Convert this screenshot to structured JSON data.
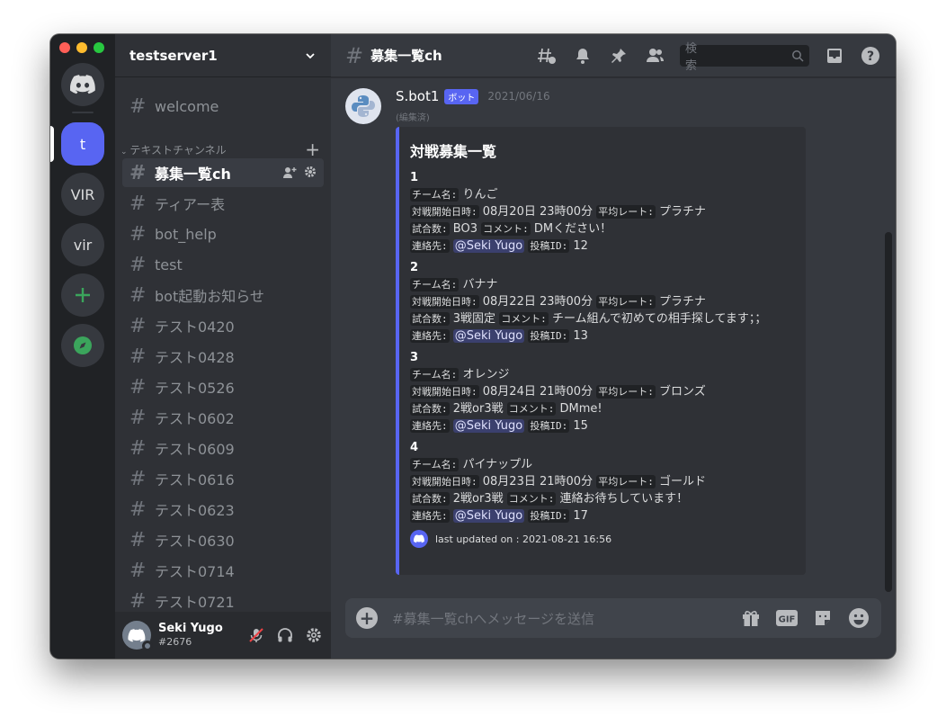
{
  "server": {
    "name": "testserver1",
    "rail": [
      {
        "label": "t"
      },
      {
        "label": "VIR"
      },
      {
        "label": "vir"
      }
    ]
  },
  "sidebar": {
    "top_channel": "welcome",
    "category": "テキストチャンネル",
    "channels": [
      {
        "label": "募集一覧ch",
        "selected": true
      },
      {
        "label": "ティアー表"
      },
      {
        "label": "bot_help"
      },
      {
        "label": "test"
      },
      {
        "label": "bot起動お知らせ"
      },
      {
        "label": "テスト0420"
      },
      {
        "label": "テスト0428"
      },
      {
        "label": "テスト0526"
      },
      {
        "label": "テスト0602"
      },
      {
        "label": "テスト0609"
      },
      {
        "label": "テスト0616"
      },
      {
        "label": "テスト0623"
      },
      {
        "label": "テスト0630"
      },
      {
        "label": "テスト0714"
      },
      {
        "label": "テスト0721"
      }
    ]
  },
  "user": {
    "name": "Seki Yugo",
    "tag": "#2676"
  },
  "topbar": {
    "channel": "募集一覧ch",
    "search_placeholder": "検索"
  },
  "message": {
    "author": "S.bot1",
    "badge": "ボット",
    "timestamp": "2021/06/16",
    "edited": "(編集済)",
    "embed": {
      "title": "対戦募集一覧",
      "labels": {
        "team": "チーム名:",
        "start": "対戦開始日時:",
        "rate": "平均レート:",
        "games": "試合数:",
        "comment": "コメント:",
        "contact": "連絡先:",
        "post_id": "投稿ID:"
      },
      "entries": [
        {
          "num": "1",
          "team": "りんご",
          "start": "08月20日 23時00分",
          "rate": "プラチナ",
          "games": "BO3",
          "comment": "DMください！",
          "contact": "@Seki Yugo",
          "post_id": "12"
        },
        {
          "num": "2",
          "team": "バナナ",
          "start": "08月22日 23時00分",
          "rate": "プラチナ",
          "games": "3戦固定",
          "comment": "チーム組んで初めての相手探してます；；",
          "contact": "@Seki Yugo",
          "post_id": "13"
        },
        {
          "num": "3",
          "team": "オレンジ",
          "start": "08月24日 21時00分",
          "rate": "ブロンズ",
          "games": "2戦or3戦",
          "comment": "DMme!",
          "contact": "@Seki Yugo",
          "post_id": "15"
        },
        {
          "num": "4",
          "team": "パイナップル",
          "start": "08月23日 21時00分",
          "rate": "ゴールド",
          "games": "2戦or3戦",
          "comment": "連絡お待ちしています！",
          "contact": "@Seki Yugo",
          "post_id": "17"
        }
      ],
      "footer": "last updated on : 2021-08-21 16:56"
    }
  },
  "composer": {
    "placeholder": "#募集一覧chへメッセージを送信"
  },
  "colors": {
    "blurple": "#5865f2",
    "green": "#3ba55c",
    "red": "#ed4245"
  }
}
